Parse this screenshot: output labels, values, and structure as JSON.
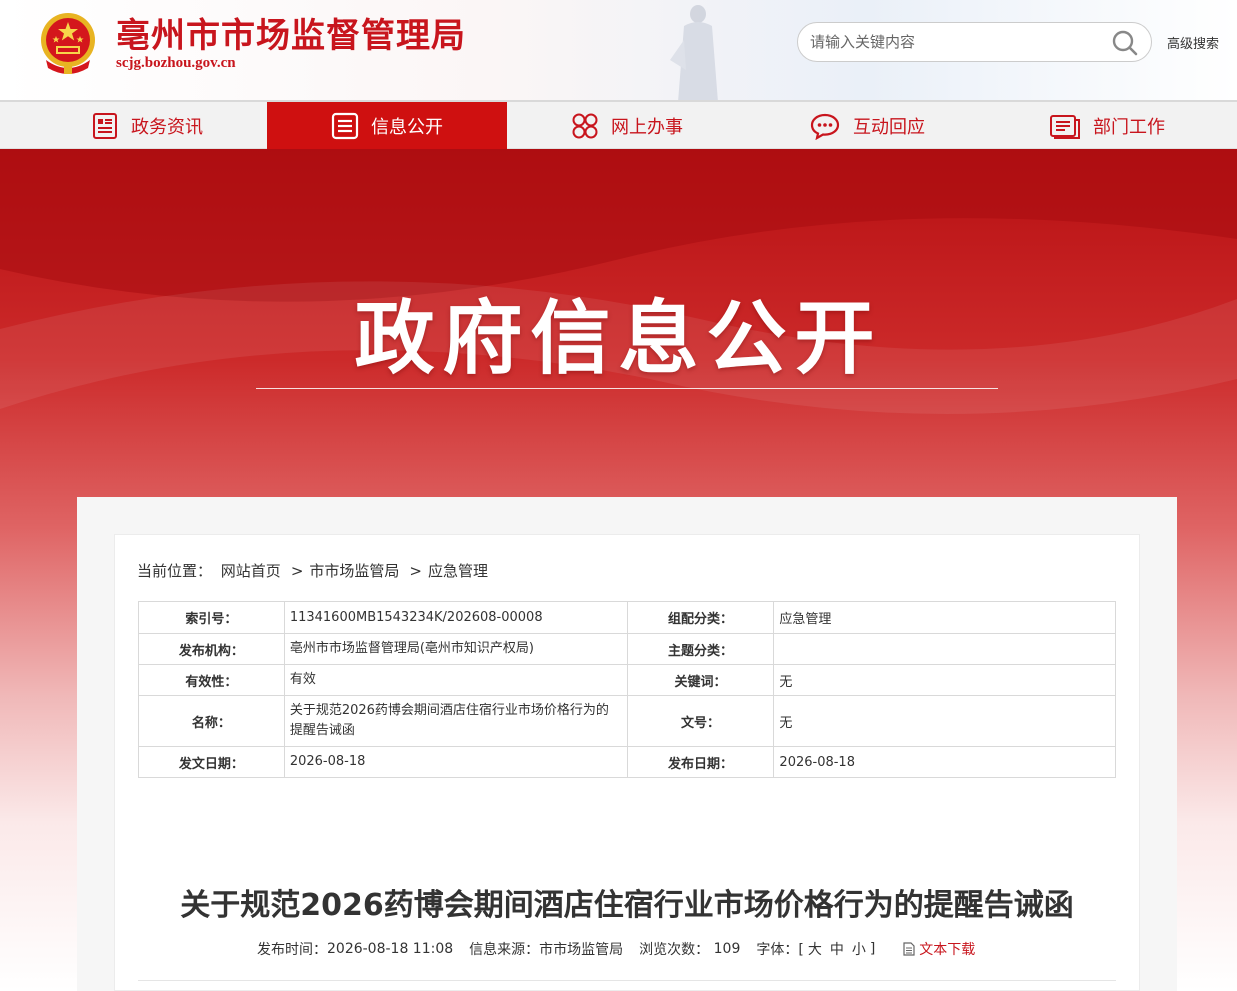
{
  "header": {
    "site_title": "亳州市市场监督管理局",
    "site_domain": "scjg.bozhou.gov.cn",
    "search_placeholder": "请输入关键内容",
    "advanced_search": "高级搜索"
  },
  "nav": {
    "items": [
      {
        "label": "政务资讯",
        "icon": "document-list-icon"
      },
      {
        "label": "信息公开",
        "icon": "list-icon",
        "active": true
      },
      {
        "label": "网上办事",
        "icon": "clover-grid-icon"
      },
      {
        "label": "互动回应",
        "icon": "chat-bubble-icon"
      },
      {
        "label": "部门工作",
        "icon": "folder-docs-icon"
      }
    ]
  },
  "banner": {
    "title": "政府信息公开"
  },
  "breadcrumb": {
    "prefix": "当前位置：",
    "items": [
      "网站首页",
      "市市场监管局",
      "应急管理"
    ],
    "separator": ">"
  },
  "meta": {
    "index_no_label": "索引号：",
    "index_no": "11341600MB1543234K/202608-00008",
    "category_label": "组配分类：",
    "category": "应急管理",
    "publisher_label": "发布机构：",
    "publisher": "亳州市市场监督管理局(亳州市知识产权局)",
    "topic_label": "主题分类：",
    "topic": "",
    "validity_label": "有效性：",
    "validity": "有效",
    "keywords_label": "关键词：",
    "keywords": "无",
    "name_label": "名称：",
    "name": "关于规范2026药博会期间酒店住宿行业市场价格行为的提醒告诫函",
    "doc_no_label": "文号：",
    "doc_no": "无",
    "issue_date_label": "发文日期：",
    "issue_date": "2026-08-18",
    "publish_date_label": "发布日期：",
    "publish_date": "2026-08-18"
  },
  "article": {
    "title": "关于规范2026药博会期间酒店住宿行业市场价格行为的提醒告诫函",
    "time_label": "发布时间：",
    "time": "2026-08-18 11:08",
    "source_label": "信息来源：",
    "source": "市市场监管局",
    "views_label": "浏览次数：",
    "views": "109",
    "font_label": "字体：[",
    "font_large": "大",
    "font_medium": "中",
    "font_small": "小",
    "font_close": "]",
    "download": "文本下载"
  },
  "colors": {
    "brand_red": "#c8151d",
    "nav_active": "#cf1010"
  }
}
